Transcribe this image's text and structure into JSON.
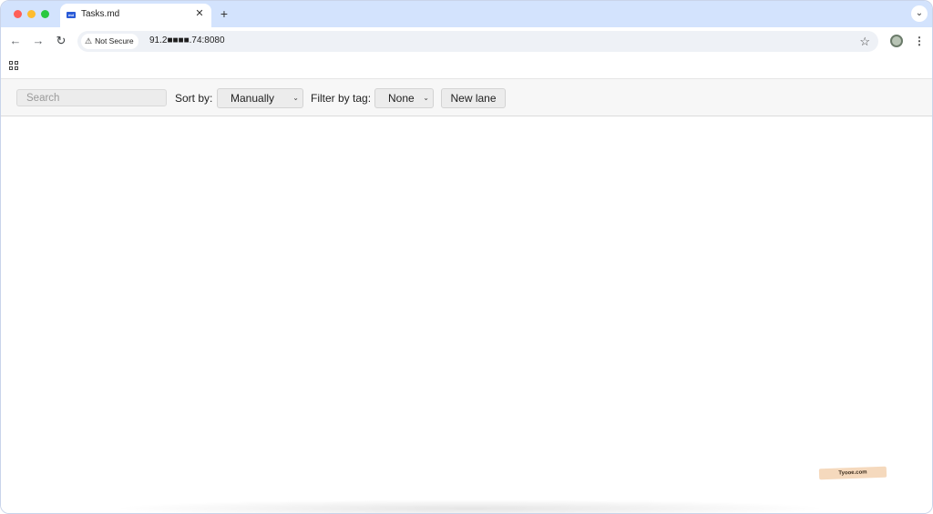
{
  "browser": {
    "tab": {
      "favicon_text": "md",
      "title": "Tasks.md",
      "close_glyph": "✕"
    },
    "new_tab_glyph": "+",
    "tab_menu_glyph": "⌄",
    "nav": {
      "back_glyph": "←",
      "forward_glyph": "→",
      "reload_glyph": "↻"
    },
    "security_label": "Not Secure",
    "url": "91.2■■■■.74:8080",
    "bookmark_glyph": "☆",
    "menu_glyph": "⋮"
  },
  "app": {
    "search": {
      "placeholder": "Search",
      "value": ""
    },
    "sort": {
      "label": "Sort by:",
      "selected": "Manually"
    },
    "filter": {
      "label": "Filter by tag:",
      "selected": "None"
    },
    "new_lane_label": "New lane"
  },
  "watermark": "Tyooe.com",
  "icons": {
    "warning": "warning-icon",
    "apps": "apps-grid-icon",
    "star": "star-icon"
  },
  "colors": {
    "tabstrip": "#d3e3fd",
    "app_bar": "#f7f7f7"
  }
}
